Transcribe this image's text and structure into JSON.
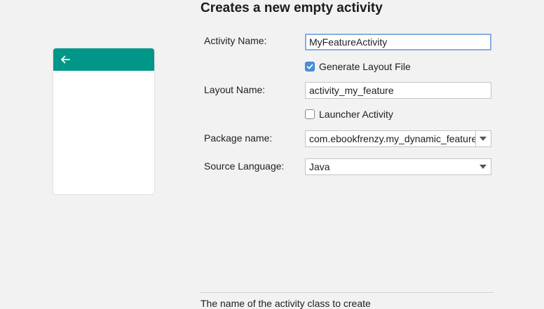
{
  "title": "Creates a new empty activity",
  "preview": {
    "appbar_color": "#009688",
    "back_icon": "arrow-back-icon"
  },
  "fields": {
    "activity_name": {
      "label": "Activity Name:",
      "value": "MyFeatureActivity"
    },
    "generate_layout": {
      "label": "Generate Layout File",
      "checked": true
    },
    "layout_name": {
      "label": "Layout Name:",
      "value": "activity_my_feature"
    },
    "launcher_activity": {
      "label": "Launcher Activity",
      "checked": false
    },
    "package_name": {
      "label": "Package name:",
      "value": "com.ebookfrenzy.my_dynamic_feature"
    },
    "source_language": {
      "label": "Source Language:",
      "value": "Java"
    }
  },
  "help_text": "The name of the activity class to create",
  "colors": {
    "accent": "#4a8fd9",
    "focus_border": "#86aee0",
    "background": "#f2f2f2"
  }
}
